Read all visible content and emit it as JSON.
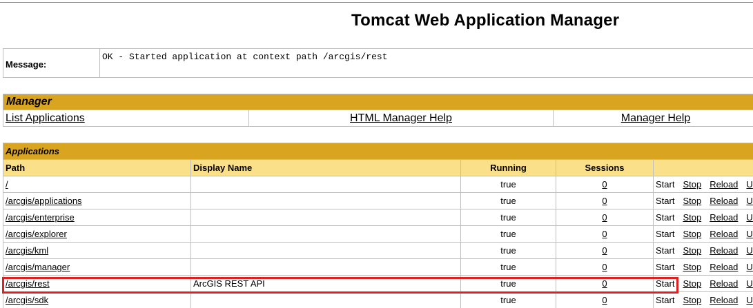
{
  "page": {
    "title": "Tomcat Web Application Manager"
  },
  "message": {
    "label": "Message:",
    "text": "OK - Started application at context path /arcgis/rest"
  },
  "manager": {
    "header": "Manager",
    "links": [
      "List Applications",
      "HTML Manager Help",
      "Manager Help"
    ]
  },
  "applications": {
    "header": "Applications",
    "columns": [
      "Path",
      "Display Name",
      "Running",
      "Sessions",
      ""
    ],
    "rows": [
      {
        "path": "/",
        "display_name": "",
        "running": "true",
        "sessions": "0"
      },
      {
        "path": "/arcgis/applications",
        "display_name": "",
        "running": "true",
        "sessions": "0"
      },
      {
        "path": "/arcgis/enterprise",
        "display_name": "",
        "running": "true",
        "sessions": "0"
      },
      {
        "path": "/arcgis/explorer",
        "display_name": "",
        "running": "true",
        "sessions": "0"
      },
      {
        "path": "/arcgis/kml",
        "display_name": "",
        "running": "true",
        "sessions": "0"
      },
      {
        "path": "/arcgis/manager",
        "display_name": "",
        "running": "true",
        "sessions": "0"
      },
      {
        "path": "/arcgis/rest",
        "display_name": "ArcGIS REST API",
        "running": "true",
        "sessions": "0"
      },
      {
        "path": "/arcgis/sdk",
        "display_name": "",
        "running": "true",
        "sessions": "0"
      }
    ],
    "commands": {
      "start": "Start",
      "stop": "Stop",
      "reload": "Reload",
      "undeploy": "U"
    }
  },
  "colors": {
    "section_header_bg": "#d9a521",
    "column_header_bg": "#fbe08a",
    "highlight": "#e02020"
  }
}
